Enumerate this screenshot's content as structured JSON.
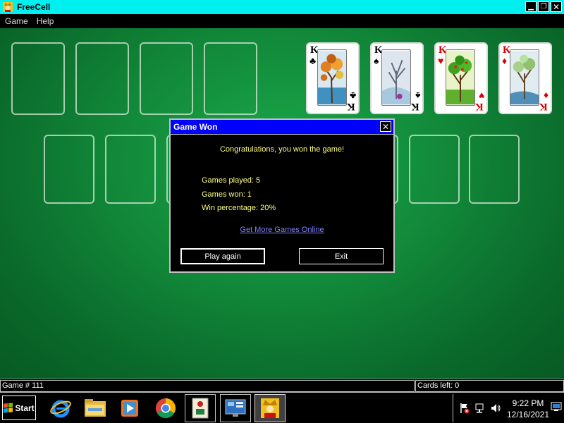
{
  "window": {
    "title": "FreeCell",
    "minimize": "▁",
    "maximize": "❐",
    "close": "✕"
  },
  "menu": [
    "Game",
    "Help"
  ],
  "foundations": [
    {
      "rank": "K",
      "suit": "♣",
      "color": "black",
      "art": "autumn-tree"
    },
    {
      "rank": "K",
      "suit": "♠",
      "color": "black",
      "art": "winter-tree"
    },
    {
      "rank": "K",
      "suit": "♥",
      "color": "red",
      "art": "summer-tree"
    },
    {
      "rank": "K",
      "suit": "♦",
      "color": "red",
      "art": "spring-tree"
    }
  ],
  "dialog": {
    "title": "Game Won",
    "close": "✕",
    "message": "Congratulations, you won the game!",
    "stats": [
      "Games played: 5",
      "Games won: 1",
      "Win percentage: 20%"
    ],
    "link": "Get More Games Online",
    "play_again": "Play again",
    "exit": "Exit"
  },
  "status": {
    "game": "Game # 111",
    "cards_left": "Cards left: 0"
  },
  "taskbar": {
    "start": "Start",
    "icons": [
      "internet-explorer-icon",
      "file-explorer-icon",
      "media-player-icon",
      "chrome-icon",
      "mahjong-icon",
      "control-panel-icon",
      "freecell-icon"
    ]
  },
  "clock": {
    "time": "9:22 PM",
    "date": "12/16/2021"
  },
  "colors": {
    "titlebar": "#00f0f0",
    "dialog_title": "#0000ff",
    "felt": "#128a3a",
    "dialog_text": "#ffff80",
    "link": "#8080ff"
  }
}
